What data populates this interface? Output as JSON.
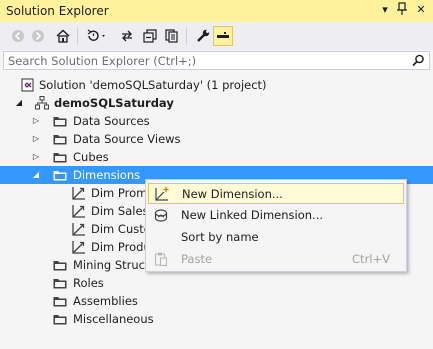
{
  "window": {
    "title": "Solution Explorer",
    "controls": [
      "▾",
      "⊥",
      "✕"
    ]
  },
  "toolbar": {
    "buttons": [
      {
        "icon": "back-arrow-icon",
        "glyph": "⊖"
      },
      {
        "icon": "forward-arrow-icon",
        "glyph": "⊕"
      },
      {
        "icon": "home-icon",
        "glyph": "⌂"
      },
      {
        "icon": "pending-changes-filter-icon",
        "glyph": "⟲▾"
      },
      {
        "icon": "sync-icon",
        "glyph": "⇄"
      },
      {
        "icon": "collapse-all-icon",
        "glyph": "⧉"
      },
      {
        "icon": "show-all-files-icon",
        "glyph": "❐"
      },
      {
        "icon": "properties-wrench-icon",
        "glyph": "🔧"
      },
      {
        "icon": "preview-icon",
        "glyph": "▬"
      }
    ]
  },
  "search": {
    "placeholder": "Search Solution Explorer (Ctrl+;)",
    "value": ""
  },
  "tree": {
    "items": [
      {
        "label": "Solution 'demoSQLSaturday' (1 project)",
        "icon": "solution-icon",
        "arrow": ""
      },
      {
        "label": "demoSQLSaturday",
        "icon": "cube-project-icon",
        "arrow": "◢"
      },
      {
        "label": "Data Sources",
        "icon": "folder-icon",
        "arrow": "▷"
      },
      {
        "label": "Data Source Views",
        "icon": "folder-icon",
        "arrow": "▷"
      },
      {
        "label": "Cubes",
        "icon": "folder-icon",
        "arrow": "▷"
      },
      {
        "label": "Dimensions",
        "icon": "folder-icon",
        "arrow": "◢"
      },
      {
        "label": "Dim Prom",
        "icon": "dimension-icon",
        "arrow": ""
      },
      {
        "label": "Dim Sales",
        "icon": "dimension-icon",
        "arrow": ""
      },
      {
        "label": "Dim Custo",
        "icon": "dimension-icon",
        "arrow": ""
      },
      {
        "label": "Dim Produ",
        "icon": "dimension-icon",
        "arrow": ""
      },
      {
        "label": "Mining Struct",
        "icon": "folder-icon",
        "arrow": ""
      },
      {
        "label": "Roles",
        "icon": "folder-icon",
        "arrow": ""
      },
      {
        "label": "Assemblies",
        "icon": "folder-icon",
        "arrow": ""
      },
      {
        "label": "Miscellaneous",
        "icon": "folder-icon",
        "arrow": ""
      }
    ]
  },
  "context_menu": {
    "items": [
      {
        "label": "New Dimension...",
        "shortcut": "",
        "icon": "new-dimension-icon"
      },
      {
        "label": "New Linked Dimension...",
        "shortcut": "",
        "icon": "new-linked-dimension-icon"
      },
      {
        "label": "Sort by name",
        "shortcut": "",
        "icon": ""
      },
      {
        "label": "Paste",
        "shortcut": "Ctrl+V",
        "icon": "paste-icon"
      }
    ]
  },
  "colors": {
    "title_bar": "#fff29d",
    "selection": "#3399ff",
    "menu_hover": "#fffbd7",
    "menu_hover_border": "#e5c365"
  }
}
